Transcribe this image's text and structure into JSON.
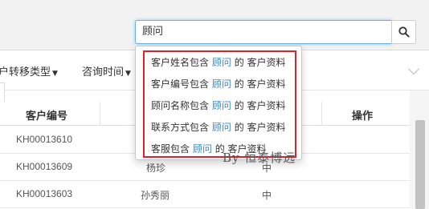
{
  "search": {
    "value": "顾问"
  },
  "filters": {
    "transfer_type": "户转移类型",
    "consult_time": "咨询时间"
  },
  "suggestions": [
    {
      "prefix": "客户姓名包含",
      "keyword": "顾问",
      "suffix": "的 客户资料"
    },
    {
      "prefix": "客户编号包含",
      "keyword": "顾问",
      "suffix": "的 客户资料"
    },
    {
      "prefix": "顾问名称包含",
      "keyword": "顾问",
      "suffix": "的 客户资料"
    },
    {
      "prefix": "联系方式包含",
      "keyword": "顾问",
      "suffix": "的 客户资料"
    },
    {
      "prefix": "客服包含",
      "keyword": "顾问",
      "suffix": "的 客户资料"
    }
  ],
  "table": {
    "columns": {
      "customer_no": "客户编号",
      "actions": "操作"
    },
    "rows": [
      {
        "id": "KH00013610",
        "name": "",
        "level": ""
      },
      {
        "id": "KH00013609",
        "name": "杨珍",
        "level": "中"
      },
      {
        "id": "KH00013603",
        "name": "孙秀丽",
        "level": "中"
      }
    ]
  },
  "watermark": "By 恒泰博远",
  "colors": {
    "highlight_border": "#e0202a",
    "keyword": "#3a87c8",
    "focus": "#66afe9"
  }
}
